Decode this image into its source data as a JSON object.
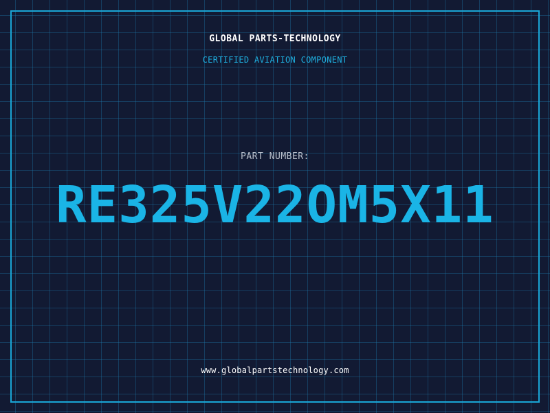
{
  "header": {
    "company": "GLOBAL PARTS-TECHNOLOGY",
    "subtitle": "CERTIFIED AVIATION COMPONENT"
  },
  "part": {
    "label": "PART NUMBER:",
    "number": "RE325V22OM5X11"
  },
  "footer": {
    "website": "www.globalpartstechnology.com"
  },
  "colors": {
    "background": "#121a33",
    "grid": "#1e78aa",
    "accent": "#1ab4e6",
    "text": "#ffffff"
  }
}
